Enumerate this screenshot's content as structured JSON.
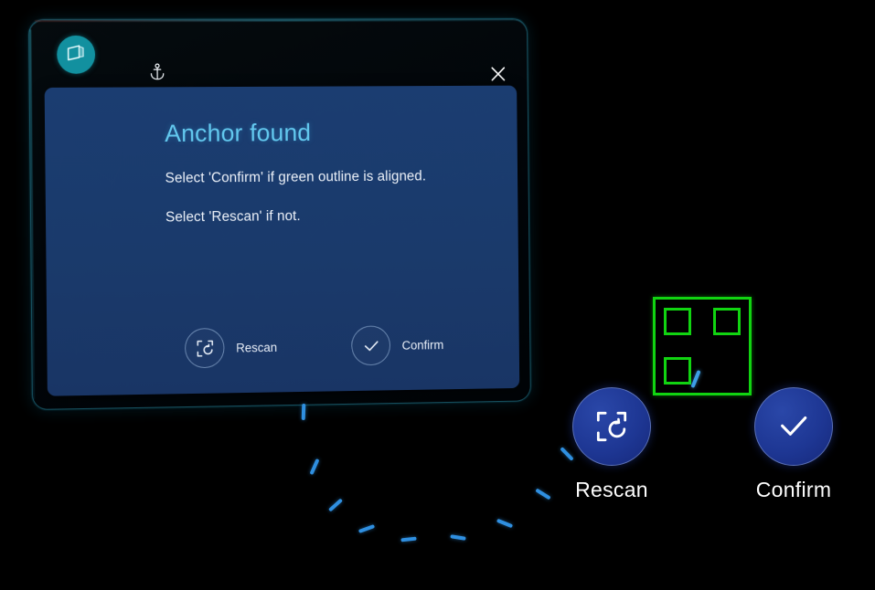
{
  "window": {
    "app_icon": "slate-3d-icon",
    "anchor_icon": "anchor-icon",
    "close_icon": "close-icon",
    "close_label": "Close"
  },
  "dialog": {
    "title": "Anchor found",
    "line1": "Select 'Confirm' if green outline is aligned.",
    "line2": "Select 'Rescan' if not.",
    "actions": [
      {
        "id": "rescan",
        "label": "Rescan",
        "icon": "rescan-icon"
      },
      {
        "id": "confirm",
        "label": "Confirm",
        "icon": "checkmark-icon"
      }
    ]
  },
  "world_buttons": [
    {
      "id": "rescan",
      "label": "Rescan",
      "icon": "rescan-icon"
    },
    {
      "id": "confirm",
      "label": "Confirm",
      "icon": "checkmark-icon"
    }
  ],
  "marker": {
    "name": "anchor-outline-marker",
    "description": "Green square QR-style anchor outline with three corner squares"
  },
  "colors": {
    "accent_teal": "#12909f",
    "panel_blue": "#1a3a6b",
    "title_blue": "#63c9ef",
    "button_blue": "#1e3794",
    "marker_green": "#11d411",
    "leader_blue": "#2f8fe0",
    "background": "#000000"
  }
}
